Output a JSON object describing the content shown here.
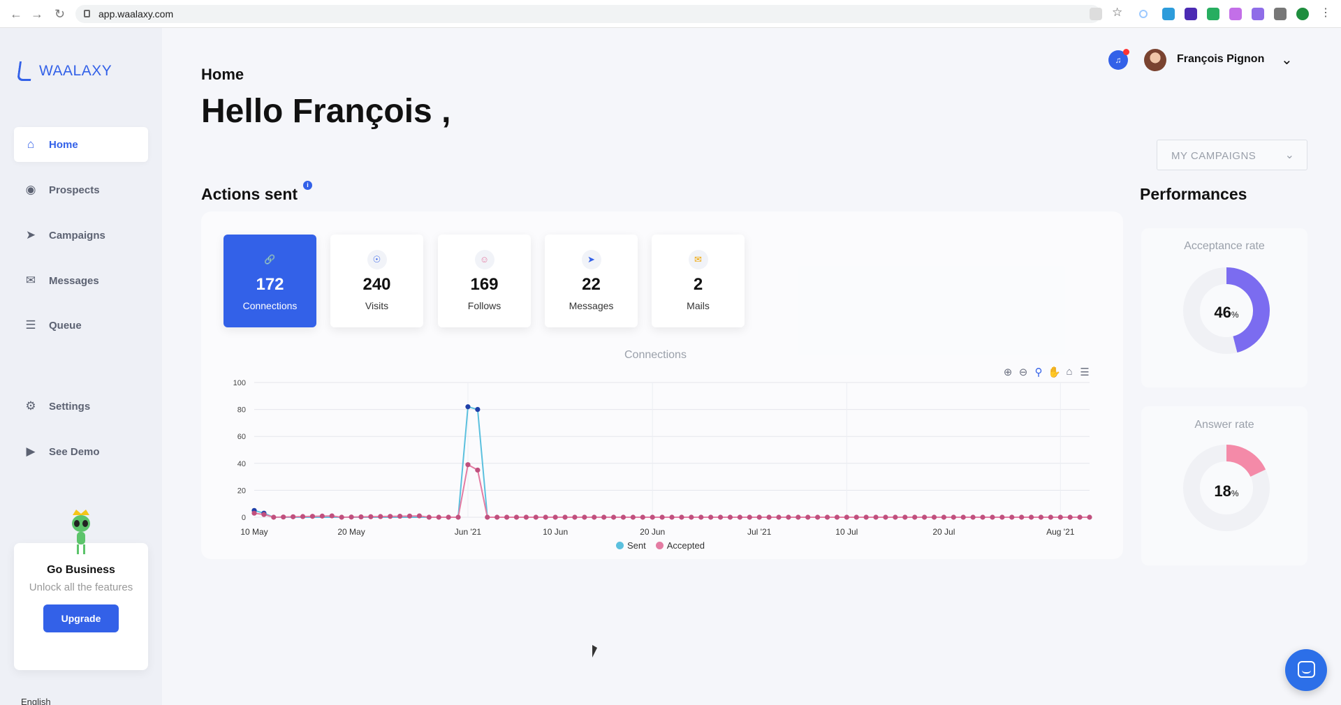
{
  "browser": {
    "url": "app.waalaxy.com"
  },
  "brand": {
    "name": "WAALAXY"
  },
  "sidebar": {
    "items": [
      {
        "label": "Home",
        "icon": "home-icon"
      },
      {
        "label": "Prospects",
        "icon": "users-icon"
      },
      {
        "label": "Campaigns",
        "icon": "rocket-icon"
      },
      {
        "label": "Messages",
        "icon": "envelope-icon"
      },
      {
        "label": "Queue",
        "icon": "queue-icon"
      },
      {
        "label": "Settings",
        "icon": "gear-icon"
      },
      {
        "label": "See Demo",
        "icon": "play-icon"
      }
    ],
    "business": {
      "title": "Go Business",
      "subtitle": "Unlock all the features",
      "button": "Upgrade"
    },
    "language": "English"
  },
  "header": {
    "page_title": "Home",
    "greeting": "Hello François ,",
    "user_name": "François Pignon",
    "campaign_filter": "MY CAMPAIGNS"
  },
  "actions": {
    "title": "Actions sent",
    "cards": [
      {
        "value": "172",
        "label": "Connections",
        "icon": "link-icon"
      },
      {
        "value": "240",
        "label": "Visits",
        "icon": "eye-icon"
      },
      {
        "value": "169",
        "label": "Follows",
        "icon": "person-icon"
      },
      {
        "value": "22",
        "label": "Messages",
        "icon": "paper-plane-icon"
      },
      {
        "value": "2",
        "label": "Mails",
        "icon": "mail-icon"
      }
    ]
  },
  "performances": {
    "title": "Performances",
    "acceptance": {
      "label": "Acceptance rate",
      "value": "46",
      "unit": "%"
    },
    "answer": {
      "label": "Answer rate",
      "value": "18",
      "unit": "%"
    }
  },
  "chart_data": {
    "type": "line",
    "title": "Connections",
    "x_ticks": [
      "10 May",
      "20 May",
      "Jun '21",
      "10 Jun",
      "20 Jun",
      "Jul '21",
      "10 Jul",
      "20 Jul",
      "Aug '21"
    ],
    "y_ticks": [
      "0",
      "20",
      "40",
      "60",
      "80",
      "100"
    ],
    "ylim": [
      0,
      100
    ],
    "x_start": "2021-05-10",
    "x_end": "2021-08-04",
    "grid": true,
    "legend": "bottom",
    "series": [
      {
        "name": "Sent",
        "color": "#5bc0de",
        "points": [
          [
            "2021-05-10",
            5
          ],
          [
            "2021-05-11",
            3
          ],
          [
            "2021-05-12",
            0
          ],
          [
            "2021-05-31",
            0
          ],
          [
            "2021-06-01",
            82
          ],
          [
            "2021-06-02",
            80
          ],
          [
            "2021-06-03",
            0
          ],
          [
            "2021-08-04",
            0
          ]
        ]
      },
      {
        "name": "Accepted",
        "color": "#e47ca3",
        "points": [
          [
            "2021-05-10",
            3
          ],
          [
            "2021-05-11",
            2
          ],
          [
            "2021-05-12",
            0
          ],
          [
            "2021-05-18",
            1
          ],
          [
            "2021-05-19",
            0
          ],
          [
            "2021-05-27",
            1
          ],
          [
            "2021-05-28",
            0
          ],
          [
            "2021-05-31",
            0
          ],
          [
            "2021-06-01",
            39
          ],
          [
            "2021-06-02",
            35
          ],
          [
            "2021-06-03",
            0
          ],
          [
            "2021-08-04",
            0
          ]
        ]
      }
    ]
  }
}
